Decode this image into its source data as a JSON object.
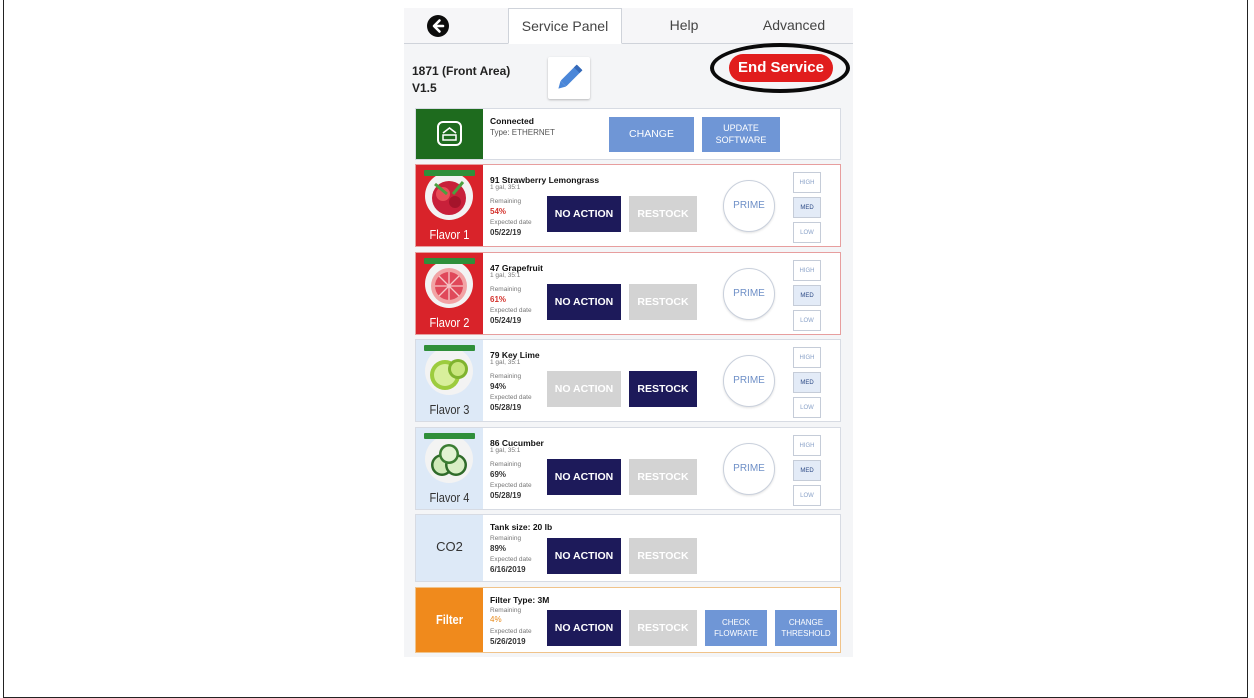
{
  "tabs": {
    "back_icon": "back-arrow-icon",
    "items": [
      "Service Panel",
      "Help",
      "Advanced"
    ],
    "active": "Service Panel"
  },
  "header": {
    "machine_name": "1871 (Front Area)",
    "version": "V1.5",
    "edit_icon": "pencil-icon",
    "end_service": "End Service"
  },
  "connection": {
    "status": "Connected",
    "type": "Type: ETHERNET",
    "change": "CHANGE",
    "update_software": "UPDATE SOFTWARE",
    "icon": "router-icon"
  },
  "labels": {
    "remaining": "Remaining",
    "expected_date": "Expected date",
    "no_action": "NO ACTION",
    "restock": "RESTOCK",
    "prime": "PRIME",
    "high": "HIGH",
    "med": "MED",
    "low": "LOW"
  },
  "flavors": [
    {
      "slot": "Flavor 1",
      "name": "91 Strawberry Lemongrass",
      "package": "1 gal, 35:1",
      "remaining": "54%",
      "expected": "05/22/19",
      "active_button": "no_action",
      "level": "MED"
    },
    {
      "slot": "Flavor 2",
      "name": "47 Grapefruit",
      "package": "1 gal, 35:1",
      "remaining": "61%",
      "expected": "05/24/19",
      "active_button": "no_action",
      "level": "MED"
    },
    {
      "slot": "Flavor 3",
      "name": "79 Key Lime",
      "package": "1 gal, 35:1",
      "remaining": "94%",
      "expected": "05/28/19",
      "active_button": "restock",
      "level": "MED"
    },
    {
      "slot": "Flavor 4",
      "name": "86 Cucumber",
      "package": "1 gal, 35:1",
      "remaining": "69%",
      "expected": "05/28/19",
      "active_button": "no_action",
      "level": "MED"
    }
  ],
  "co2": {
    "label": "CO2",
    "tank": "Tank size: 20 lb",
    "remaining": "89%",
    "expected": "6/16/2019"
  },
  "filter": {
    "label": "Filter",
    "type": "Filter Type: 3M",
    "remaining": "4%",
    "expected": "5/26/2019",
    "check_flowrate": "CHECK FLOWRATE",
    "change_threshold": "CHANGE THRESHOLD"
  },
  "colors": {
    "flavor_red": "#d9232a",
    "flavor_light": "#dde9f7",
    "navy": "#1d1a5a",
    "accent_blue": "#6f96d6",
    "end_service_red": "#e11d1d",
    "filter_orange": "#f08a1c",
    "connection_green": "#1e6b1e"
  }
}
